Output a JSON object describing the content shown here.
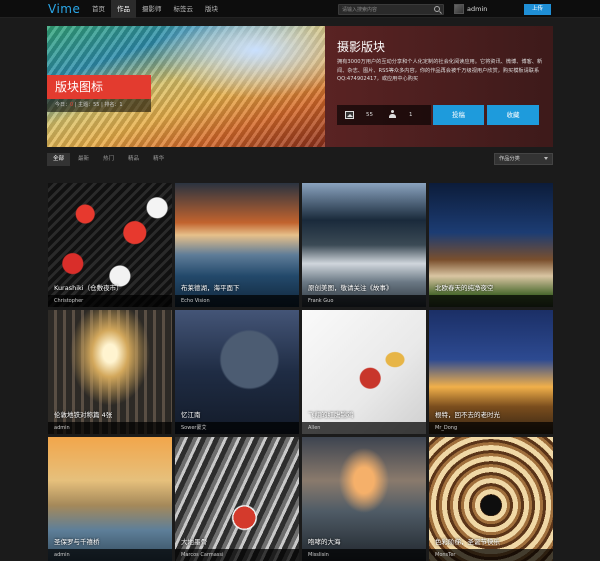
{
  "nav": {
    "logo": "Vime",
    "items": [
      "首页",
      "作品",
      "摄影师",
      "标签云",
      "版块"
    ],
    "active_index": 1,
    "search_placeholder": "请输入搜索内容",
    "username": "admin",
    "upload_label": "上传"
  },
  "hero": {
    "badge": "版块图标",
    "stats": {
      "today_label": "今日：",
      "today_value": "0",
      "posts_label": "主题：",
      "posts_value": "55",
      "rank_label": "排名：",
      "rank_value": "1",
      "sep": "|"
    },
    "title": "摄影版块",
    "description": "拥有3000万用户的互动分享和个人化定制的社会化阅读应用。它将资讯、微博、博客、新闻、杂志、图片、RSS等众多内容，你的作品再会被千万级视用户欣赏，购买模板请联系QQ:474902417，或应用中心购买",
    "pic_count": "55",
    "member_count": "1",
    "post_label": "投稿",
    "fav_label": "收藏"
  },
  "filters": {
    "tabs": [
      "全部",
      "最新",
      "热门",
      "精品",
      "精华"
    ],
    "active_index": 0,
    "category_label": "作品分类"
  },
  "cards": [
    {
      "caption": "Kurashiki（仓敷夜市）",
      "author": "Christopher"
    },
    {
      "caption": "布莱德湖，海平面下",
      "author": "Echo Vision"
    },
    {
      "caption": "原创美图，敬请关注《故事》",
      "author": "Frank Guo"
    },
    {
      "caption": "北欧春天的纯净夜空",
      "author": ""
    },
    {
      "caption": "伦敦地铁对称篇 4张",
      "author": "admin"
    },
    {
      "caption": "忆江南",
      "author": "Sower蒙艾"
    },
    {
      "caption": "飞翔的红腹锦鸡",
      "author": "Allen"
    },
    {
      "caption": "根特，回不去的老时光",
      "author": "Mr_Dong"
    },
    {
      "caption": "圣保罗与千禧桥",
      "author": "admin"
    },
    {
      "caption": "大地墨骨",
      "author": "Marcos Carmassi"
    },
    {
      "caption": "咆哮的大海",
      "author": "Misslisin"
    },
    {
      "caption": "色彩阶梯，圣诞节快乐",
      "author": "MonsTer"
    }
  ]
}
